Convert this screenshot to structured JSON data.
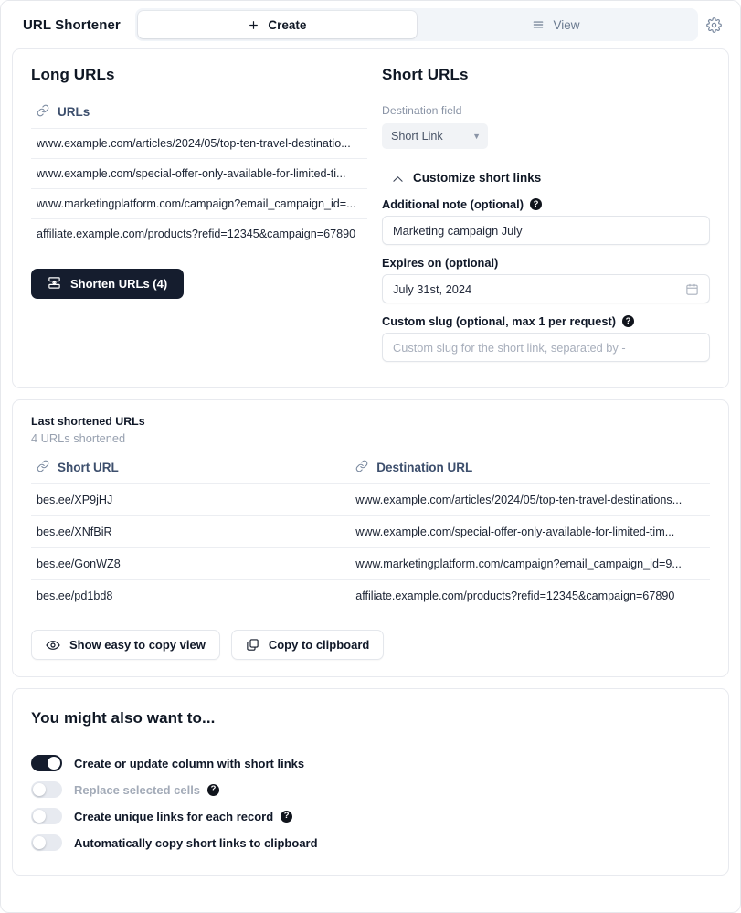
{
  "header": {
    "app_title": "URL Shortener",
    "tabs": [
      {
        "label": "Create",
        "icon": "plus-icon",
        "active": true
      },
      {
        "label": "View",
        "icon": "list-icon",
        "active": false
      }
    ],
    "settings_icon": "gear-icon"
  },
  "builder": {
    "left": {
      "title": "Long URLs",
      "column_header": "URLs",
      "column_header_icon": "link-icon",
      "rows": [
        "www.example.com/articles/2024/05/top-ten-travel-destinatio...",
        "www.example.com/special-offer-only-available-for-limited-ti...",
        "www.marketingplatform.com/campaign?email_campaign_id=...",
        "affiliate.example.com/products?refid=12345&campaign=67890"
      ],
      "shorten_button": {
        "label": "Shorten URLs (4)",
        "icon": "shorten-icon",
        "color": "#151d2e"
      }
    },
    "right": {
      "title": "Short URLs",
      "destination_field_label": "Destination field",
      "destination_field_value": "Short Link",
      "destination_field_caret": "chevron-down-icon",
      "customize_toggle": {
        "label": "Customize short links",
        "icon": "chevron-up-icon"
      },
      "fields": [
        {
          "label": "Additional note (optional)",
          "help": "?",
          "value": "Marketing campaign July",
          "placeholder": "",
          "is_placeholder": false,
          "trailing_icon": ""
        },
        {
          "label": "Expires on (optional)",
          "help": "",
          "value": "July 31st, 2024",
          "placeholder": "",
          "is_placeholder": false,
          "trailing_icon": "calendar-icon"
        },
        {
          "label": "Custom slug (optional, max 1 per request)",
          "help": "?",
          "value": "Custom slug for the short link, separated by -",
          "placeholder": "Custom slug for the short link, separated by -",
          "is_placeholder": true,
          "trailing_icon": ""
        }
      ]
    }
  },
  "results": {
    "title": "Last shortened URLs",
    "subtitle": "4 URLs shortened",
    "columns": [
      {
        "label": "Short URL",
        "icon": "link-icon"
      },
      {
        "label": "Destination URL",
        "icon": "link-icon"
      }
    ],
    "rows": [
      {
        "short": "bes.ee/XP9jHJ",
        "destination": "www.example.com/articles/2024/05/top-ten-travel-destinations..."
      },
      {
        "short": "bes.ee/XNfBiR",
        "destination": "www.example.com/special-offer-only-available-for-limited-tim..."
      },
      {
        "short": "bes.ee/GonWZ8",
        "destination": "www.marketingplatform.com/campaign?email_campaign_id=9..."
      },
      {
        "short": "bes.ee/pd1bd8",
        "destination": "affiliate.example.com/products?refid=12345&campaign=67890"
      }
    ],
    "buttons": [
      {
        "label": "Show easy to copy view",
        "icon": "eye-icon"
      },
      {
        "label": "Copy to clipboard",
        "icon": "copy-icon"
      }
    ]
  },
  "suggestions": {
    "title": "You might also want to...",
    "toggles": [
      {
        "label": "Create or update column with short links",
        "on": true,
        "disabled": false,
        "help": ""
      },
      {
        "label": "Replace selected cells",
        "on": false,
        "disabled": true,
        "help": "?"
      },
      {
        "label": "Create unique links for each record",
        "on": false,
        "disabled": false,
        "help": "?"
      },
      {
        "label": "Automatically copy short links to clipboard",
        "on": false,
        "disabled": false,
        "help": ""
      }
    ]
  }
}
